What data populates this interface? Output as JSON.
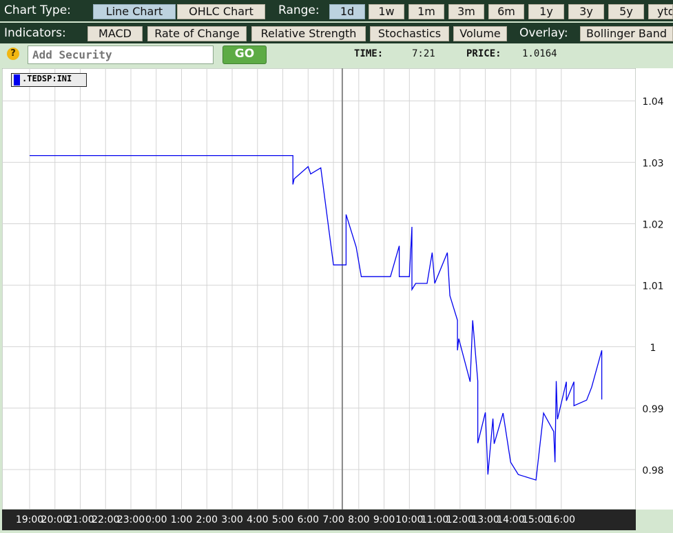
{
  "toolbar": {
    "chart_type_label": "Chart Type:",
    "chart_types": [
      {
        "label": "Line Chart",
        "selected": true
      },
      {
        "label": "OHLC Chart",
        "selected": false
      }
    ],
    "range_label": "Range:",
    "ranges": [
      {
        "label": "1d",
        "selected": true
      },
      {
        "label": "1w",
        "selected": false
      },
      {
        "label": "1m",
        "selected": false
      },
      {
        "label": "3m",
        "selected": false
      },
      {
        "label": "6m",
        "selected": false
      },
      {
        "label": "1y",
        "selected": false
      },
      {
        "label": "3y",
        "selected": false
      },
      {
        "label": "5y",
        "selected": false
      },
      {
        "label": "ytd",
        "selected": false
      }
    ],
    "indicators_label": "Indicators:",
    "indicators": [
      "MACD",
      "Rate of Change",
      "Relative Strength",
      "Stochastics",
      "Volume"
    ],
    "overlay_label": "Overlay:",
    "overlays": [
      "Bollinger Band"
    ]
  },
  "security": {
    "help_glyph": "?",
    "add_placeholder": "Add Security",
    "go_label": "GO",
    "time_label": "TIME:",
    "time_value": "7:21",
    "price_label": "PRICE:",
    "price_value": "1.0164"
  },
  "colors": {
    "series": "#0000ee",
    "grid": "#d4d4d4",
    "crosshair": "#888888",
    "toolbar_bg": "#1f3a29",
    "panel_bg": "#d4e7d0"
  },
  "chart_data": {
    "type": "line",
    "legend": ".TEDSP:INI",
    "y_ticks": [
      0.98,
      0.99,
      1.0,
      1.01,
      1.02,
      1.03,
      1.04
    ],
    "y_tick_labels": [
      "0.98",
      "0.99",
      "1",
      "1.01",
      "1.02",
      "1.03",
      "1.04"
    ],
    "ylim": [
      0.9735,
      1.0453
    ],
    "x_tick_labels": [
      "19:00",
      "20:00",
      "21:00",
      "22:00",
      "23:00",
      "0:00",
      "1:00",
      "2:00",
      "3:00",
      "4:00",
      "5:00",
      "6:00",
      "7:00",
      "8:00",
      "9:00",
      "10:00",
      "11:00",
      "12:00",
      "13:00",
      "14:00",
      "15:00",
      "16:00"
    ],
    "xlim": [
      0,
      22.8
    ],
    "crosshair_time": "7:21",
    "series": [
      {
        "values": [
          [
            0.0,
            1.0311
          ],
          [
            10.4,
            1.0311
          ],
          [
            10.4,
            1.0264
          ],
          [
            10.45,
            1.0273
          ],
          [
            11.0,
            1.0293
          ],
          [
            11.1,
            1.0281
          ],
          [
            11.5,
            1.0291
          ],
          [
            12.0,
            1.0133
          ],
          [
            12.5,
            1.0133
          ],
          [
            12.5,
            1.0215
          ],
          [
            12.9,
            1.0162
          ],
          [
            13.1,
            1.0114
          ],
          [
            14.25,
            1.0114
          ],
          [
            14.6,
            1.0164
          ],
          [
            14.6,
            1.0114
          ],
          [
            15.0,
            1.0114
          ],
          [
            15.1,
            1.0195
          ],
          [
            15.1,
            1.0093
          ],
          [
            15.25,
            1.0103
          ],
          [
            15.7,
            1.0103
          ],
          [
            15.9,
            1.0153
          ],
          [
            16.0,
            1.0103
          ],
          [
            16.5,
            1.0153
          ],
          [
            16.6,
            1.0083
          ],
          [
            16.9,
            1.0043
          ],
          [
            16.9,
            0.9994
          ],
          [
            16.95,
            1.0013
          ],
          [
            17.4,
            0.9943
          ],
          [
            17.5,
            1.0043
          ],
          [
            17.7,
            0.9944
          ],
          [
            17.7,
            0.9843
          ],
          [
            18.0,
            0.9893
          ],
          [
            18.1,
            0.9792
          ],
          [
            18.3,
            0.9883
          ],
          [
            18.35,
            0.9842
          ],
          [
            18.7,
            0.9892
          ],
          [
            19.0,
            0.9812
          ],
          [
            19.3,
            0.9792
          ],
          [
            20.0,
            0.9783
          ],
          [
            20.3,
            0.9892
          ],
          [
            20.7,
            0.9862
          ],
          [
            20.75,
            0.9812
          ],
          [
            20.8,
            0.9944
          ],
          [
            20.85,
            0.9882
          ],
          [
            21.2,
            0.9943
          ],
          [
            21.2,
            0.9912
          ],
          [
            21.5,
            0.9943
          ],
          [
            21.5,
            0.9904
          ],
          [
            22.0,
            0.9913
          ],
          [
            22.2,
            0.9934
          ],
          [
            22.6,
            0.9994
          ],
          [
            22.6,
            0.9914
          ]
        ]
      }
    ]
  }
}
